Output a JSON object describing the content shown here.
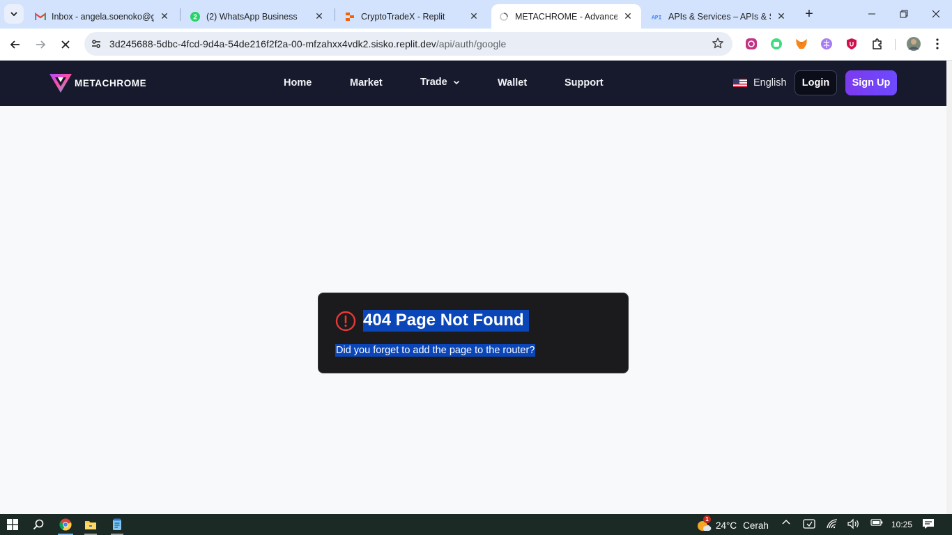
{
  "browser": {
    "tabs": [
      {
        "title": "Inbox - angela.soenoko@gmail.com",
        "icon": "gmail-icon",
        "active": false
      },
      {
        "title": "(2) WhatsApp Business",
        "icon": "whatsapp-icon",
        "active": false
      },
      {
        "title": "CryptoTradeX - Replit",
        "icon": "replit-icon",
        "active": false
      },
      {
        "title": "METACHROME - Advanced Crypto Trading",
        "icon": "loading-icon",
        "active": true
      },
      {
        "title": "APIs & Services – APIs & Services",
        "icon": "api-icon",
        "active": false
      }
    ],
    "address": {
      "host": "3d245688-5dbc-4fcd-9d4a-54de216f2f2a-00-mfzahxx4vdk2.sisko.replit.dev",
      "path": "/api/auth/google"
    }
  },
  "site": {
    "logo_text": "METACHROME",
    "nav": {
      "home": "Home",
      "market": "Market",
      "trade": "Trade",
      "wallet": "Wallet",
      "support": "Support"
    },
    "language": "English",
    "login": "Login",
    "signup": "Sign Up"
  },
  "error": {
    "title": "404 Page Not Found",
    "message": "Did you forget to add the page to the router?"
  },
  "taskbar": {
    "weather_temp": "24°C",
    "weather_text": "Cerah",
    "weather_badge": "1",
    "time": "10:25"
  },
  "colors": {
    "nav_bg": "#171a2c",
    "signup_bg": "#7c3aed",
    "card_bg": "#1b1a1d",
    "selection": "#0b46b9",
    "error_icon": "#e53935"
  }
}
